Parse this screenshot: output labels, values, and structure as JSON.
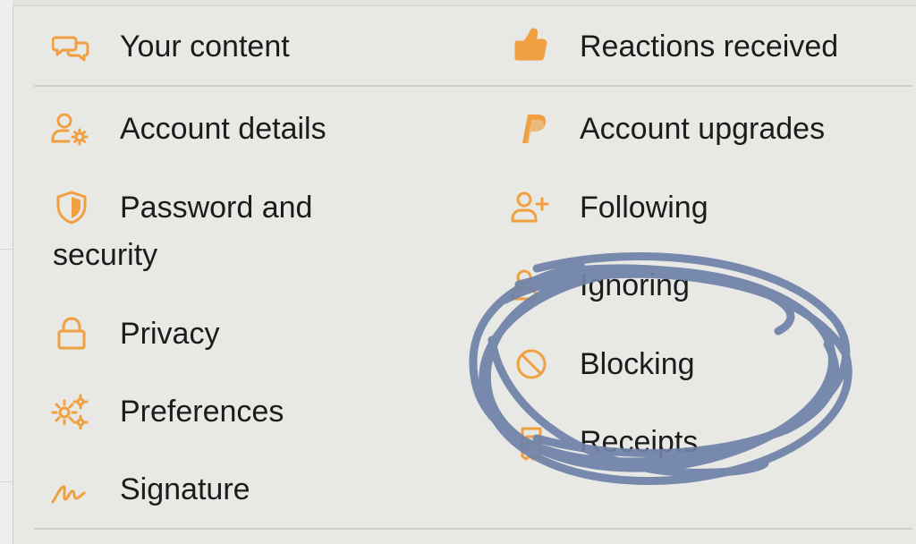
{
  "accent_color": "#f0a040",
  "annotation_color": "#6f82a8",
  "account_menu": {
    "left_column": [
      {
        "label": "Your content",
        "icon": "speech-bubbles-icon"
      },
      {
        "label": "Account details",
        "icon": "user-gear-icon"
      },
      {
        "label_line1": "Password and",
        "label_line2": "security",
        "icon": "shield-icon"
      },
      {
        "label": "Privacy",
        "icon": "lock-icon"
      },
      {
        "label": "Preferences",
        "icon": "gears-icon"
      },
      {
        "label": "Signature",
        "icon": "signature-icon"
      }
    ],
    "right_column": [
      {
        "label": "Reactions received",
        "icon": "thumbs-up-icon"
      },
      {
        "label": "Account upgrades",
        "icon": "paypal-icon"
      },
      {
        "label": "Following",
        "icon": "user-plus-icon"
      },
      {
        "label": "Ignoring",
        "icon": "user-minus-icon"
      },
      {
        "label": "Blocking",
        "icon": "block-icon"
      },
      {
        "label": "Receipts",
        "icon": "receipt-icon"
      }
    ]
  }
}
